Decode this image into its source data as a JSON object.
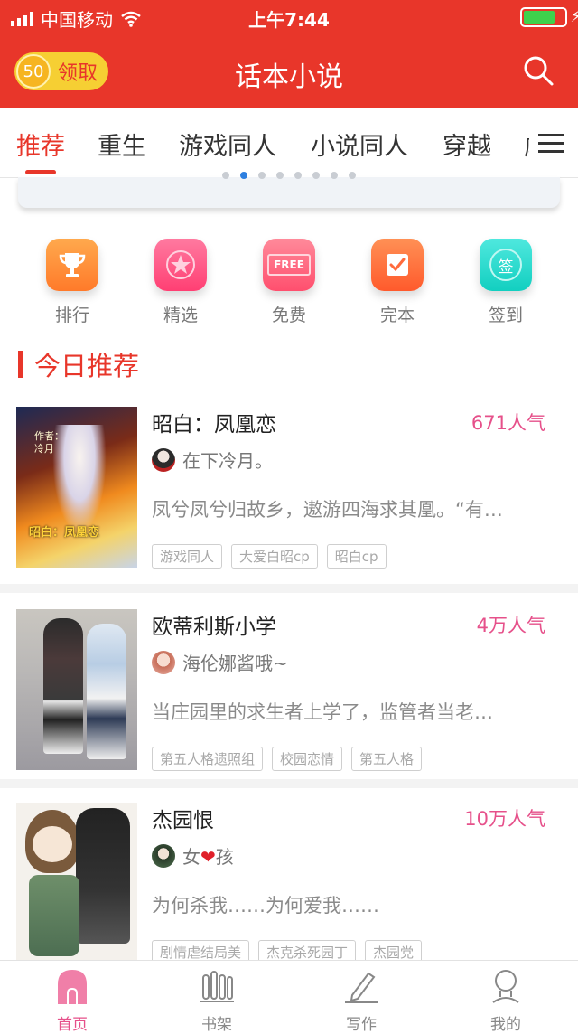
{
  "status_bar": {
    "carrier": "中国移动",
    "time": "上午7:44"
  },
  "header": {
    "title": "话本小说",
    "coins": "50",
    "claim_label": "领取"
  },
  "tabs": [
    "推荐",
    "重生",
    "游戏同人",
    "小说同人",
    "穿越",
    "虐"
  ],
  "quick_links": [
    {
      "label": "排行",
      "icon": "trophy-icon",
      "color": "#ff8a2b"
    },
    {
      "label": "精选",
      "icon": "star-icon",
      "color": "#ff4d7e"
    },
    {
      "label": "免费",
      "icon": "free-icon",
      "color": "#ff5a76",
      "badge": "FREE"
    },
    {
      "label": "完本",
      "icon": "check-icon",
      "color": "#ff6b3d"
    },
    {
      "label": "签到",
      "icon": "sign-in-icon",
      "color": "#1ed6c8",
      "badge": "签"
    }
  ],
  "section_title": "今日推荐",
  "books": [
    {
      "title": "昭白：凤凰恋",
      "popularity": "671人气",
      "author": "在下冷月。",
      "description": "凤兮凤兮归故乡，遨游四海求其凰。“有…",
      "tags": [
        "游戏同人",
        "大爱白昭cp",
        "昭白cp"
      ],
      "cover_text": [
        "作者：",
        "冷月",
        "昭白：凤凰恋"
      ]
    },
    {
      "title": "欧蒂利斯小学",
      "popularity": "4万人气",
      "author": "海伦娜酱哦~",
      "description": "当庄园里的求生者上学了，监管者当老…",
      "tags": [
        "第五人格遗照组",
        "校园恋情",
        "第五人格"
      ]
    },
    {
      "title": "杰园恨",
      "popularity": "10万人气",
      "author_prefix": "女",
      "author_heart": "❤",
      "author_suffix": "孩",
      "description": "为何杀我……为何爱我……",
      "tags": [
        "剧情虐结局美",
        "杰克杀死园丁",
        "杰园党"
      ]
    }
  ],
  "bottom_nav": [
    {
      "label": "首页",
      "icon": "home-icon",
      "active": true
    },
    {
      "label": "书架",
      "icon": "bookshelf-icon",
      "active": false
    },
    {
      "label": "写作",
      "icon": "pen-icon",
      "active": false
    },
    {
      "label": "我的",
      "icon": "profile-icon",
      "active": false
    }
  ],
  "colors": {
    "brand": "#e8362a",
    "popularity": "#e6508a"
  }
}
